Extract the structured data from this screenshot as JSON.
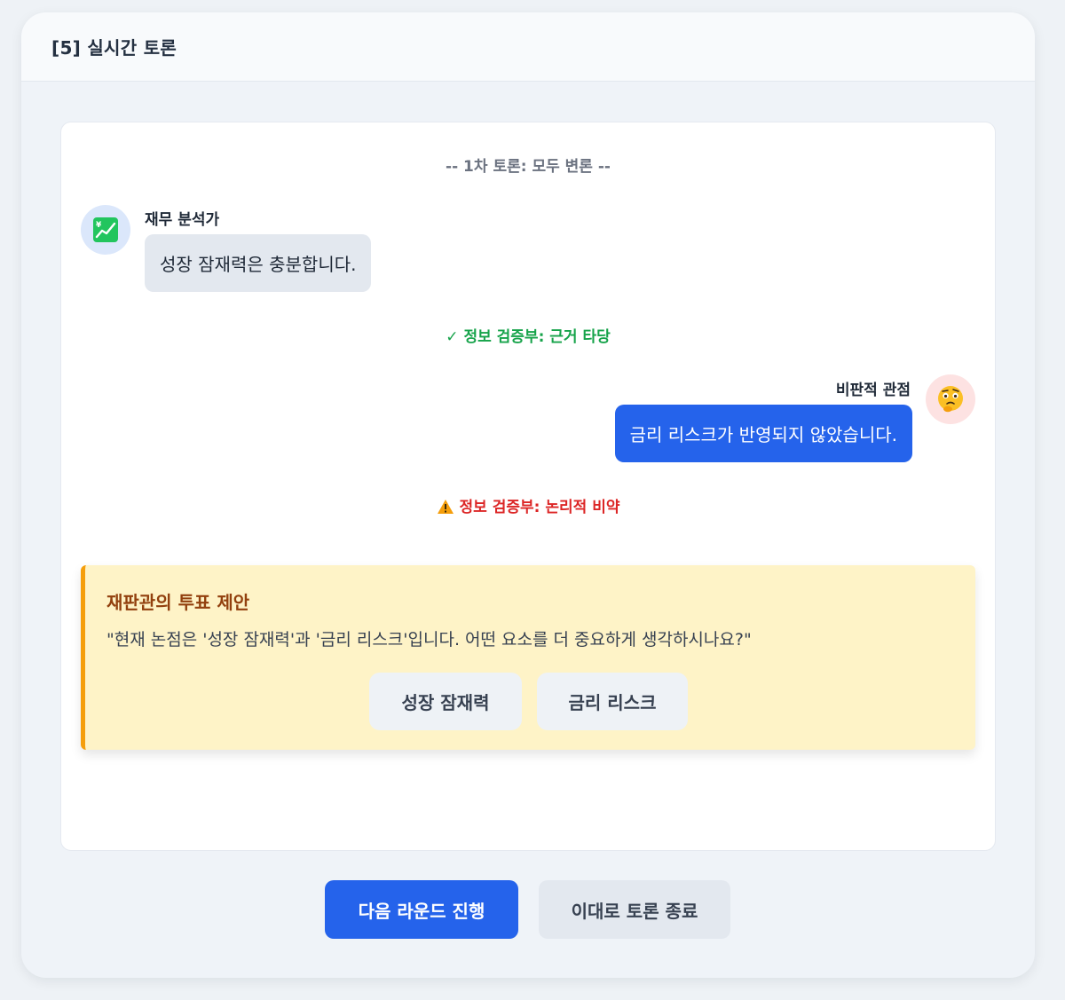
{
  "header": {
    "title": "[5] 실시간 토론"
  },
  "debate": {
    "round_label": "-- 1차 토론: 모두 변론 --",
    "messages": [
      {
        "speaker": "재무 분석가",
        "avatar_icon": "chart-increasing-icon",
        "text": "성장 잠재력은 충분합니다.",
        "side": "left"
      },
      {
        "speaker": "비판적 관점",
        "avatar_icon": "thinking-face-icon",
        "text": "금리 리스크가 반영되지 않았습니다.",
        "side": "right"
      }
    ],
    "verifications": [
      {
        "icon": "check-icon",
        "symbol": "✓",
        "text": "정보 검증부: 근거 타당",
        "status": "valid",
        "color": "#16a34a"
      },
      {
        "icon": "warning-icon",
        "text": "정보 검증부: 논리적 비약",
        "status": "warning",
        "color": "#dc2626"
      }
    ]
  },
  "vote": {
    "title": "재판관의 투표 제안",
    "question": "\"현재 논점은 '성장 잠재력'과 '금리 리스크'입니다. 어떤 요소를 더 중요하게 생각하시나요?\"",
    "options": [
      "성장 잠재력",
      "금리 리스크"
    ]
  },
  "actions": {
    "next_round": "다음 라운드 진행",
    "end_debate": "이대로 토론 종료"
  },
  "colors": {
    "accent": "#2563eb",
    "valid": "#16a34a",
    "warning": "#dc2626",
    "vote_bg": "#fef3c7",
    "vote_border": "#f59e0b"
  }
}
